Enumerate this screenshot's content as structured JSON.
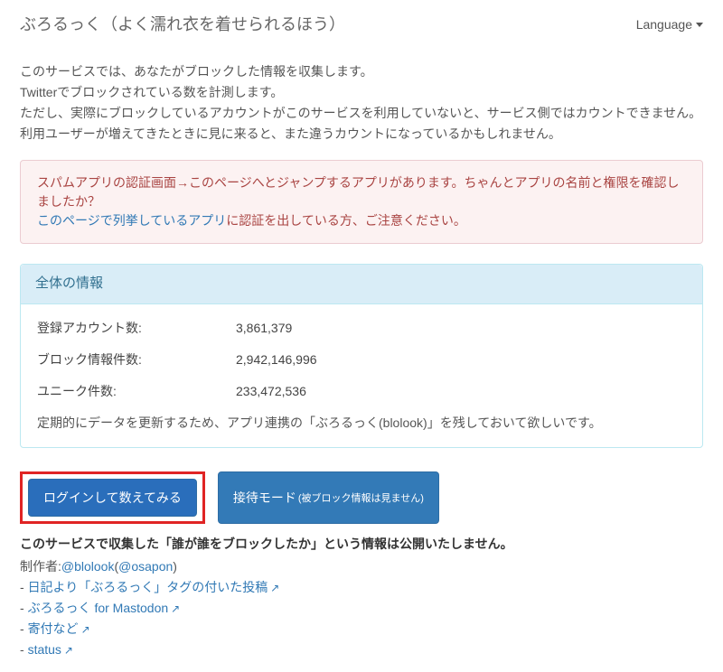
{
  "header": {
    "title": "ぶろるっく（よく濡れ衣を着せられるほう）",
    "language_label": "Language"
  },
  "intro": {
    "l1": "このサービスでは、あなたがブロックした情報を収集します。",
    "l2": "Twitterでブロックされている数を計測します。",
    "l3": "ただし、実際にブロックしているアカウントがこのサービスを利用していないと、サービス側ではカウントできません。",
    "l4": "利用ユーザーが増えてきたときに見に来ると、また違うカウントになっているかもしれません。"
  },
  "alert": {
    "l1": "スパムアプリの認証画面→このページへとジャンプするアプリがあります。ちゃんとアプリの名前と権限を確認しましたか？",
    "l2_link": "このページで列挙しているアプリ",
    "l2_after": "に認証を出している方、ご注意ください。"
  },
  "panel": {
    "title": "全体の情報",
    "rows": [
      {
        "label": "登録アカウント数:",
        "value": "3,861,379"
      },
      {
        "label": "ブロック情報件数:",
        "value": "2,942,146,996"
      },
      {
        "label": "ユニーク件数:",
        "value": "233,472,536"
      }
    ],
    "note": "定期的にデータを更新するため、アプリ連携の「ぶろるっく(blolook)」を残しておいて欲しいです。"
  },
  "buttons": {
    "login": "ログインして数えてみる",
    "spectator": "接待モード",
    "spectator_sub": "(被ブロック情報は見ません)"
  },
  "footer": {
    "disclosure": "このサービスで収集した「誰が誰をブロックしたか」という情報は公開いたしません。",
    "author_prefix": "制作者:",
    "author_link1": "@blolook",
    "author_paren_open": "(",
    "author_link2": "@osapon",
    "author_paren_close": ")",
    "links": [
      "日記より「ぶろるっく」タグの付いた投稿",
      "ぶろるっく for Mastodon",
      "寄付など",
      "status"
    ]
  }
}
